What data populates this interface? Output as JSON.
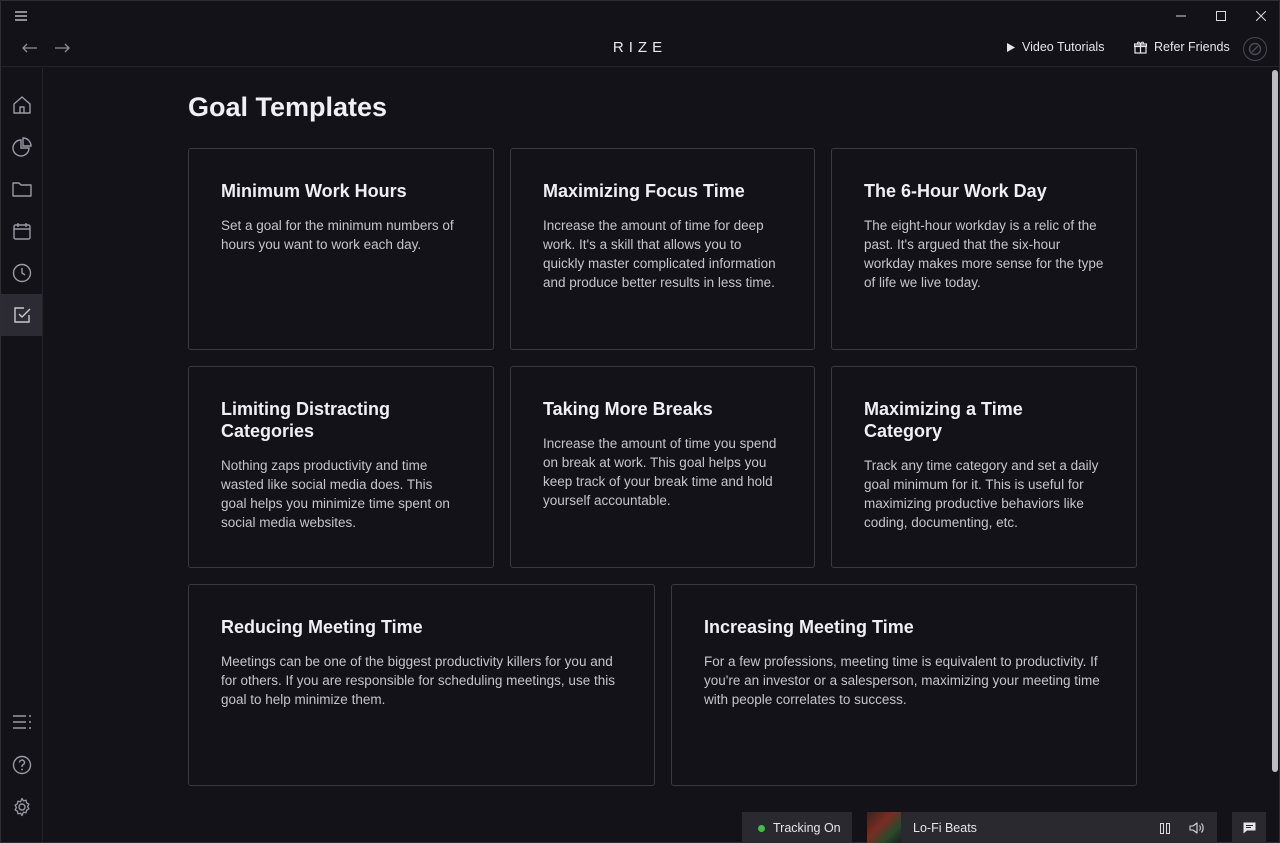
{
  "app": {
    "brand": "RIZE"
  },
  "navbar": {
    "video_tutorials": "Video Tutorials",
    "refer_friends": "Refer Friends"
  },
  "sidebar": {
    "items": [
      {
        "icon": "home-icon"
      },
      {
        "icon": "pie-chart-icon"
      },
      {
        "icon": "folder-icon"
      },
      {
        "icon": "calendar-icon"
      },
      {
        "icon": "clock-icon"
      },
      {
        "icon": "check-square-icon",
        "active": true
      },
      {
        "icon": "list-icon"
      },
      {
        "icon": "help-icon"
      },
      {
        "icon": "settings-icon"
      }
    ]
  },
  "main": {
    "title": "Goal Templates",
    "cards": [
      {
        "title": "Minimum Work Hours",
        "desc": "Set a goal for the minimum numbers of hours you want to work each day."
      },
      {
        "title": "Maximizing Focus Time",
        "desc": "Increase the amount of time for deep work. It's a skill that allows you to quickly master complicated information and produce better results in less time."
      },
      {
        "title": "The 6-Hour Work Day",
        "desc": "The eight-hour workday is a relic of the past. It's argued that the six-hour workday makes more sense for the type of life we live today."
      },
      {
        "title": "Limiting Distracting Categories",
        "desc": "Nothing zaps productivity and time wasted like social media does. This goal helps you minimize time spent on social media websites."
      },
      {
        "title": "Taking More Breaks",
        "desc": "Increase the amount of time you spend on break at work. This goal helps you keep track of your break time and hold yourself accountable."
      },
      {
        "title": "Maximizing a Time Category",
        "desc": "Track any time category and set a daily goal minimum for it. This is useful for maximizing productive behaviors like coding, documenting, etc."
      },
      {
        "title": "Reducing Meeting Time",
        "desc": "Meetings can be one of the biggest productivity killers for you and for others. If you are responsible for scheduling meetings, use this goal to help minimize them."
      },
      {
        "title": "Increasing Meeting Time",
        "desc": "For a few professions, meeting time is equivalent to productivity. If you're an investor or a salesperson, maximizing your meeting time with people correlates to success."
      }
    ]
  },
  "footer": {
    "tracking_label": "Tracking On",
    "tracking_color": "#3ec23e",
    "player_title": "Lo-Fi Beats"
  }
}
